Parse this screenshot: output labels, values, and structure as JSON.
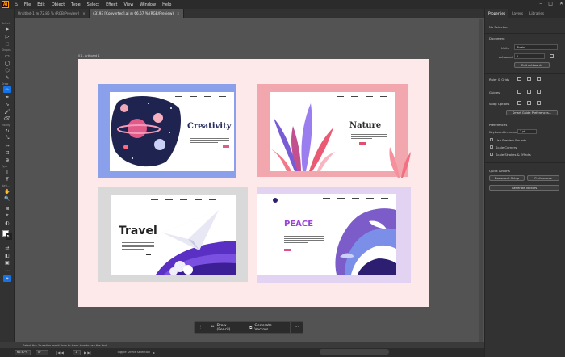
{
  "menubar": {
    "logo": "Ai",
    "items": [
      "File",
      "Edit",
      "Object",
      "Type",
      "Select",
      "Effect",
      "View",
      "Window",
      "Help"
    ]
  },
  "tabs": [
    {
      "label": "Untitled-1 @ 72.86 % (RGB/Preview)",
      "active": false
    },
    {
      "label": "43193 [Converted].ai @ 66.67 % (RGB/Preview)",
      "active": true
    }
  ],
  "toolbar_sections": [
    "Select",
    "Shapes",
    "Draw",
    "Modify",
    "Type",
    "Navi..."
  ],
  "artboard": {
    "label": "01 - Artboard 1"
  },
  "cards": {
    "creativity": {
      "title": "Creativity"
    },
    "nature": {
      "title": "Nature"
    },
    "travel": {
      "title": "Travel"
    },
    "peace": {
      "title": "PEACE"
    }
  },
  "right_panel": {
    "tabs": [
      "Properties",
      "Layers",
      "Libraries"
    ],
    "no_selection": "No Selection",
    "document_label": "Document",
    "units_label": "Units",
    "units_value": "Pixels",
    "artboard_label": "Artboard",
    "artboard_value": "1",
    "edit_artboards": "Edit Artboards",
    "ruler_grids": "Ruler & Grids",
    "guides": "Guides",
    "snap_options": "Snap Options",
    "smart_guides": "Smart Guide Preferences...",
    "preferences": "Preferences",
    "keyboard_increment_label": "Keyboard Increment:",
    "keyboard_increment_value": "1 pt",
    "check_preview_bounds": "Use Preview Bounds",
    "check_scale_corners": "Scale Corners",
    "check_scale_strokes": "Scale Strokes & Effects",
    "quick_actions": "Quick Actions",
    "document_setup": "Document Setup",
    "preferences_btn": "Preferences",
    "generate_vectors": "Generate Vectors"
  },
  "context_bar": {
    "draw": "Draw (Pencil)",
    "generate": "Generate Vectors"
  },
  "status": {
    "zoom": "66.67%",
    "rotation": "0°",
    "page": "1",
    "mode": "Toggle Direct Selection",
    "tip": "Select the 'Question mark' icon to learn how to use the tool."
  }
}
